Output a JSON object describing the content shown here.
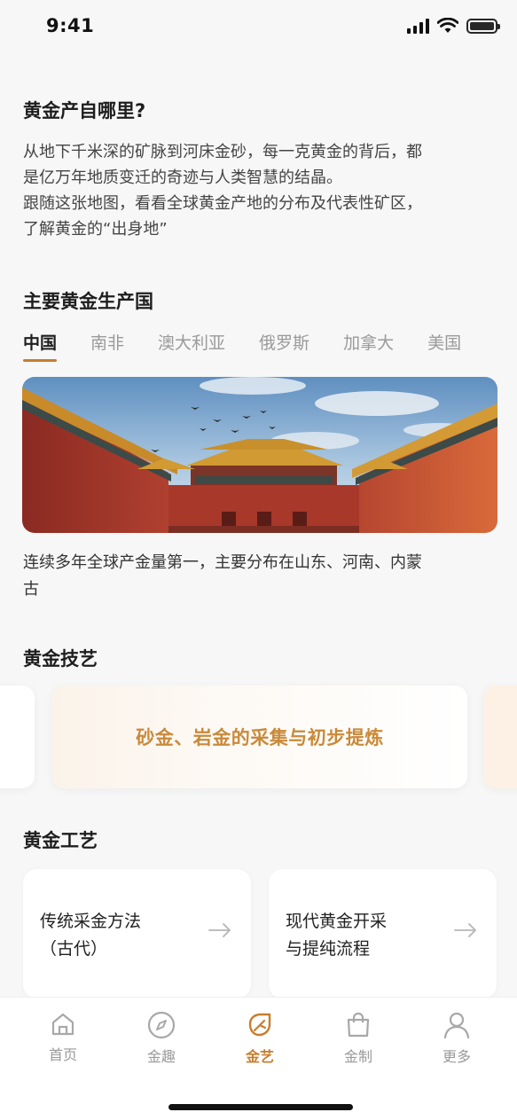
{
  "status_bar": {
    "time": "9:41"
  },
  "intro": {
    "title": "黄金产自哪里?",
    "line1": "从地下千米深的矿脉到河床金砂，每一克黄金的背后，都",
    "line2": "是亿万年地质变迁的奇迹与人类智慧的结晶。",
    "line3": "跟随这张地图，看看全球黄金产地的分布及代表性矿区，",
    "line4": "了解黄金的“出身地”"
  },
  "producers": {
    "title": "主要黄金生产国",
    "tabs": [
      "中国",
      "南非",
      "澳大利亚",
      "俄罗斯",
      "加拿大",
      "美国"
    ],
    "active_tab": "中国",
    "caption_line1": "连续多年全球产金量第一，主要分布在山东、河南、内蒙",
    "caption_line2": "古"
  },
  "skills": {
    "title": "黄金技艺",
    "card_text": "砂金、岩金的采集与初步提炼"
  },
  "crafts": {
    "title": "黄金工艺",
    "cards": [
      {
        "line1": "传统采金方法",
        "line2": "（古代）"
      },
      {
        "line1": "现代黄金开采",
        "line2": "与提纯流程"
      }
    ]
  },
  "tabbar": {
    "items": [
      {
        "label": "首页",
        "icon": "home-icon"
      },
      {
        "label": "金趣",
        "icon": "compass-icon"
      },
      {
        "label": "金艺",
        "icon": "leaf-icon"
      },
      {
        "label": "金制",
        "icon": "shopping-bag-icon"
      },
      {
        "label": "更多",
        "icon": "user-icon"
      }
    ],
    "active": "金艺"
  },
  "colors": {
    "accent": "#c87d2c",
    "background": "#f7f7f7"
  }
}
